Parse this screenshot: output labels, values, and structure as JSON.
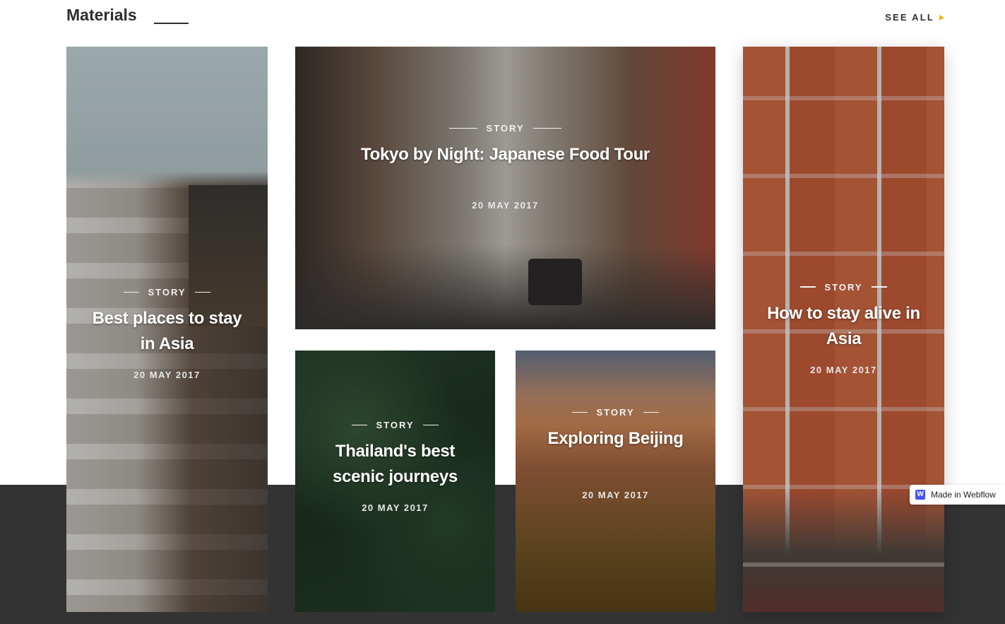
{
  "section": {
    "title": "Materials",
    "see_all_label": "SEE ALL"
  },
  "cards": [
    {
      "tag": "STORY",
      "title": "Best places to stay in Asia",
      "date": "20 MAY 2017"
    },
    {
      "tag": "STORY",
      "title": "Tokyo by Night: Japanese Food Tour",
      "date": "20 MAY 2017"
    },
    {
      "tag": "STORY",
      "title": "Thailand's best scenic journeys",
      "date": "20 MAY 2017"
    },
    {
      "tag": "STORY",
      "title": "Exploring Beijing",
      "date": "20 MAY 2017"
    },
    {
      "tag": "STORY",
      "title": "How to stay alive in Asia",
      "date": "20 MAY 2017"
    }
  ],
  "badge": {
    "logo_letter": "W",
    "label": "Made in Webflow"
  },
  "colors": {
    "accent": "#f2b705",
    "dark_band": "#333333",
    "text": "#2e2e2e",
    "webflow_blue": "#4353ff"
  },
  "icons": [
    "chevron-right-icon",
    "webflow-logo-icon"
  ]
}
